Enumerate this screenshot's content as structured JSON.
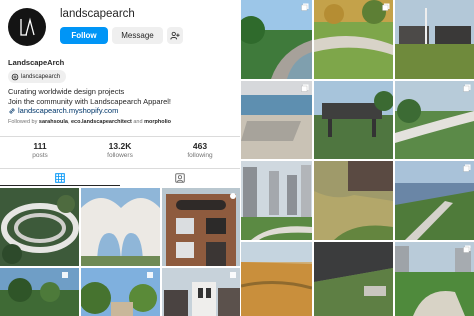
{
  "profile": {
    "username": "landscapearch",
    "follow_label": "Follow",
    "message_label": "Message",
    "display_name": "LandscapeArch",
    "threads_handle": "landscapearch",
    "bio": [
      "Curating worldwide design projects",
      "Join the community with Landscapearch Apparel!"
    ],
    "link": "landscapearch.myshopify.com",
    "followed_by_prefix": "Followed by",
    "followed_by_user1": "sarahsoula",
    "followed_by_user2": "eco.landscapearchitect",
    "followed_by_and": "and",
    "followed_by_user3": "morpholio",
    "stats": [
      {
        "value": "111",
        "label": "posts"
      },
      {
        "value": "13.2K",
        "label": "followers"
      },
      {
        "value": "463",
        "label": "following"
      }
    ]
  },
  "icons": {
    "posts_tab": "grid-icon",
    "tagged_tab": "tagged-icon",
    "link": "link-icon",
    "threads": "threads-icon",
    "add_user": "add-user-icon",
    "carousel": "carousel-icon"
  },
  "colors": {
    "accent": "#0095f6",
    "link": "#00376b",
    "muted": "#737373"
  }
}
